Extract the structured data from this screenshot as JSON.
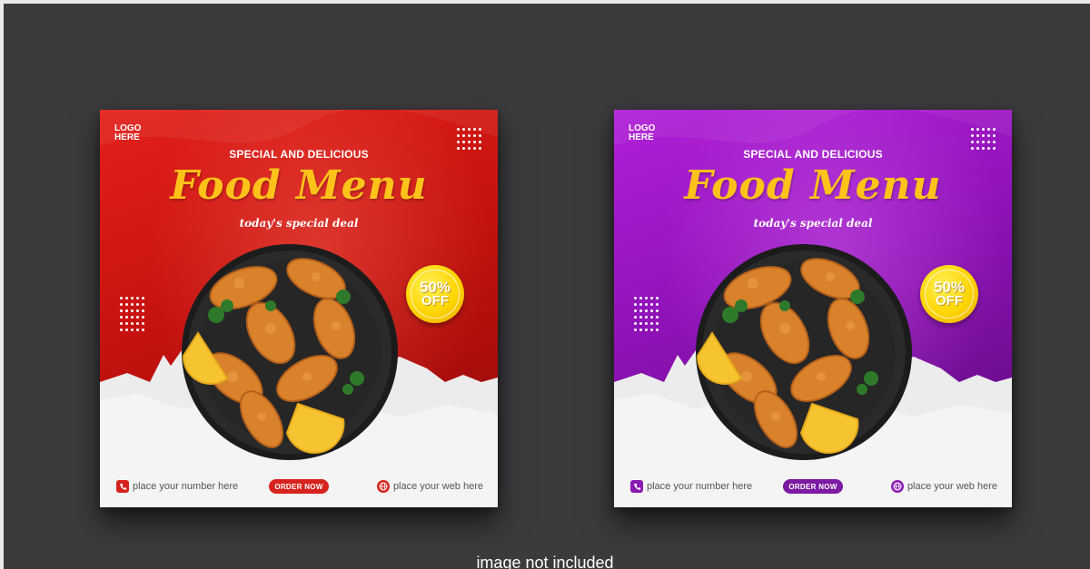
{
  "caption": "image not included",
  "cards": [
    {
      "theme": "red",
      "accent": "#d7231d",
      "logo_line1": "LOGO",
      "logo_line2": "HERE",
      "subtitle": "SPECIAL AND DELICIOUS",
      "title": "Food Menu",
      "tagline": "today's special deal",
      "badge_percent": "50%",
      "badge_off": "OFF",
      "phone_text": "place your number here",
      "order_label": "ORDER NOW",
      "web_text": "place your web here",
      "icons": [
        "phone-icon",
        "globe-icon"
      ]
    },
    {
      "theme": "purple",
      "accent": "#8b1bb3",
      "logo_line1": "LOGO",
      "logo_line2": "HERE",
      "subtitle": "SPECIAL AND DELICIOUS",
      "title": "Food Menu",
      "tagline": "today's special deal",
      "badge_percent": "50%",
      "badge_off": "OFF",
      "phone_text": "place your number here",
      "order_label": "ORDER NOW",
      "web_text": "place your web here",
      "icons": [
        "phone-icon",
        "globe-icon"
      ]
    }
  ]
}
